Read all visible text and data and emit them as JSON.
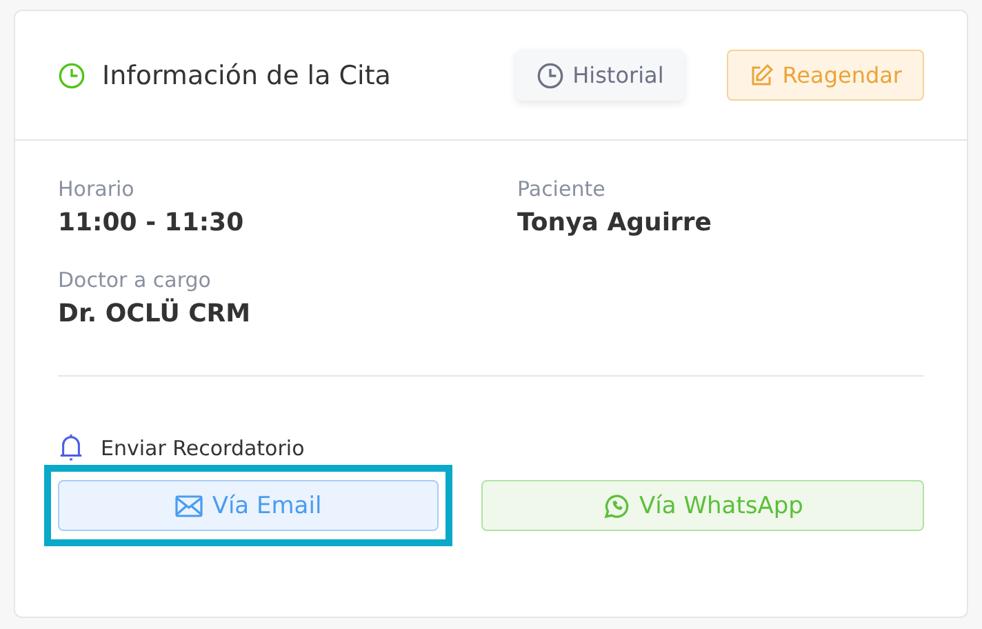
{
  "header": {
    "title": "Información de la Cita",
    "actions": [
      {
        "kind": "history",
        "label": "Historial"
      },
      {
        "kind": "reschedule",
        "label": "Reagendar"
      }
    ]
  },
  "fields": [
    {
      "label": "Horario",
      "value": "11:00 - 11:30"
    },
    {
      "label": "Paciente",
      "value": "Tonya Aguirre"
    },
    {
      "label": "Doctor a cargo",
      "value": "Dr. OCLÜ CRM"
    }
  ],
  "reminder": {
    "title": "Enviar Recordatorio",
    "buttons": [
      {
        "kind": "email",
        "label": "Vía Email",
        "selected": true
      },
      {
        "kind": "whatsapp",
        "label": "Vía WhatsApp",
        "selected": false
      }
    ]
  }
}
